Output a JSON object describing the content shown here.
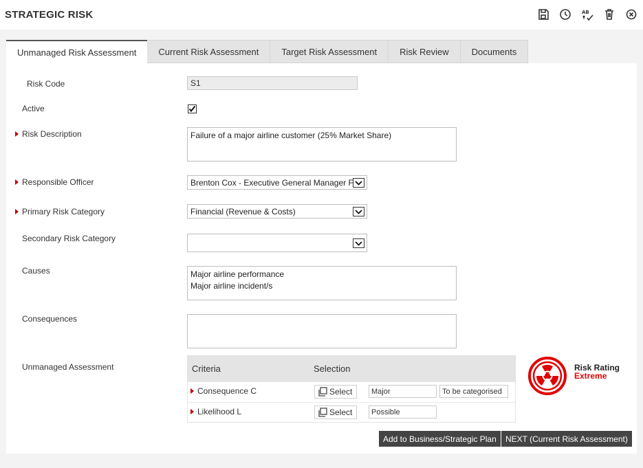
{
  "header": {
    "title": "STRATEGIC RISK",
    "tools": [
      "save-icon",
      "history-icon",
      "spellcheck-icon",
      "delete-icon",
      "close-icon"
    ]
  },
  "tabs": [
    {
      "label": "Unmanaged Risk Assessment",
      "active": true
    },
    {
      "label": "Current Risk Assessment",
      "active": false
    },
    {
      "label": "Target Risk Assessment",
      "active": false
    },
    {
      "label": "Risk Review",
      "active": false
    },
    {
      "label": "Documents",
      "active": false
    }
  ],
  "form": {
    "risk_code_label": "Risk Code",
    "risk_code_value": "S1",
    "active_label": "Active",
    "active_checked": true,
    "risk_description_label": "Risk Description",
    "risk_description_value": "Failure of a major airline customer (25% Market Share)",
    "responsible_officer_label": "Responsible Officer",
    "responsible_officer_value": "Brenton Cox - Executive General Manager Fi",
    "primary_category_label": "Primary Risk Category",
    "primary_category_value": "Financial (Revenue & Costs)",
    "secondary_category_label": "Secondary Risk Category",
    "secondary_category_value": "",
    "causes_label": "Causes",
    "causes_line1": "Major airline performance",
    "causes_line2": "Major airline incident/s",
    "consequences_label": "Consequences",
    "consequences_value": "",
    "unmanaged_label": "Unmanaged Assessment"
  },
  "assessment": {
    "col_criteria": "Criteria",
    "col_selection": "Selection",
    "rows": [
      {
        "criteria": "Consequence C",
        "button": "Select",
        "value": "Major",
        "extra": "To be categorised"
      },
      {
        "criteria": "Likelihood L",
        "button": "Select",
        "value": "Possible"
      }
    ]
  },
  "rating": {
    "label": "Risk Rating",
    "value": "Extreme",
    "color": "#e00000",
    "icon": "radiation-icon"
  },
  "actions": {
    "add_plan": "Add to Business/Strategic Plan",
    "next": "NEXT (Current Risk Assessment)"
  }
}
